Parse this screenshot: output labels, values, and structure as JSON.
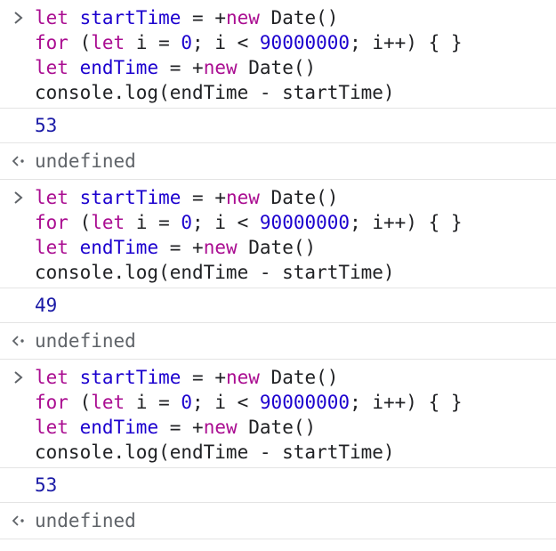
{
  "colors": {
    "keyword": "#aa0d91",
    "variable": "#1c00cf",
    "number": "#1c00cf",
    "output_number": "#1a1aa6",
    "undefined_text": "#5f6368",
    "separator": "#e4e4e4"
  },
  "icons": {
    "input_prompt": "chevron-right-icon",
    "return_value": "return-arrow-icon"
  },
  "entries": [
    {
      "code": {
        "l1": {
          "kw": "let",
          "var": "startTime",
          "mid": " = +",
          "kw2": "new",
          "rest": " Date()"
        },
        "l2": {
          "kw": "for",
          "a": " (",
          "kw2": "let",
          "b": " i = ",
          "n1": "0",
          "c": "; i < ",
          "n2": "90000000",
          "d": "; i++) { }"
        },
        "l3": {
          "kw": "let",
          "var": "endTime",
          "mid": " = +",
          "kw2": "new",
          "rest": " Date()"
        },
        "l4": "console.log(endTime - startTime)"
      },
      "output": "53",
      "result": "undefined"
    },
    {
      "code": {
        "l1": {
          "kw": "let",
          "var": "startTime",
          "mid": " = +",
          "kw2": "new",
          "rest": " Date()"
        },
        "l2": {
          "kw": "for",
          "a": " (",
          "kw2": "let",
          "b": " i = ",
          "n1": "0",
          "c": "; i < ",
          "n2": "90000000",
          "d": "; i++) { }"
        },
        "l3": {
          "kw": "let",
          "var": "endTime",
          "mid": " = +",
          "kw2": "new",
          "rest": " Date()"
        },
        "l4": "console.log(endTime - startTime)"
      },
      "output": "49",
      "result": "undefined"
    },
    {
      "code": {
        "l1": {
          "kw": "let",
          "var": "startTime",
          "mid": " = +",
          "kw2": "new",
          "rest": " Date()"
        },
        "l2": {
          "kw": "for",
          "a": " (",
          "kw2": "let",
          "b": " i = ",
          "n1": "0",
          "c": "; i < ",
          "n2": "90000000",
          "d": "; i++) { }"
        },
        "l3": {
          "kw": "let",
          "var": "endTime",
          "mid": " = +",
          "kw2": "new",
          "rest": " Date()"
        },
        "l4": "console.log(endTime - startTime)"
      },
      "output": "53",
      "result": "undefined"
    }
  ]
}
